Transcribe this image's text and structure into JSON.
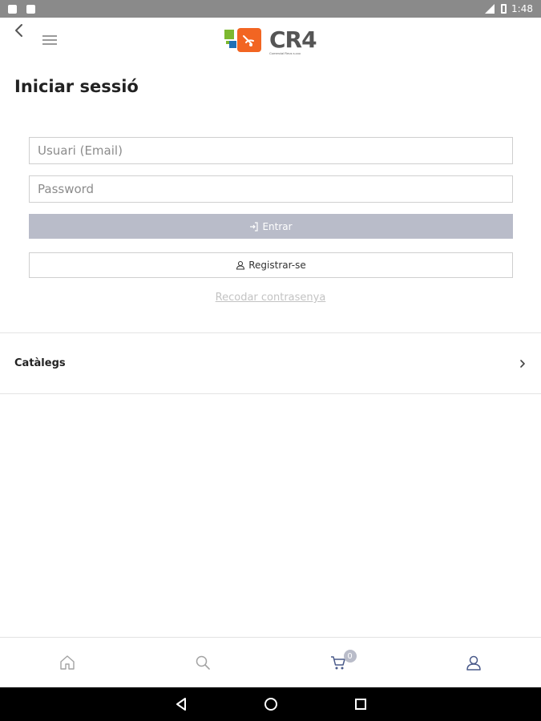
{
  "status_bar": {
    "time": "1:48"
  },
  "header": {
    "logo_name": "CR4",
    "logo_tagline": "Comercial Reus s.coo"
  },
  "page": {
    "title": "Iniciar sessió"
  },
  "login_form": {
    "email_placeholder": "Usuari (Email)",
    "email_value": "",
    "password_placeholder": "Password",
    "password_value": "",
    "submit_label": "Entrar",
    "register_label": "Registrar-se",
    "forgot_label": "Recodar contrasenya"
  },
  "sections": {
    "catalogs_label": "Catàlegs"
  },
  "bottom_nav": {
    "cart_count": "0",
    "items": [
      "home-icon",
      "search-icon",
      "cart-icon",
      "user-icon"
    ]
  },
  "colors": {
    "primary_button": "#b9bcc9",
    "accent": "#4a5a8a",
    "logo_green": "#7cb82f",
    "logo_orange": "#f26522",
    "logo_blue": "#1f6fb5"
  }
}
